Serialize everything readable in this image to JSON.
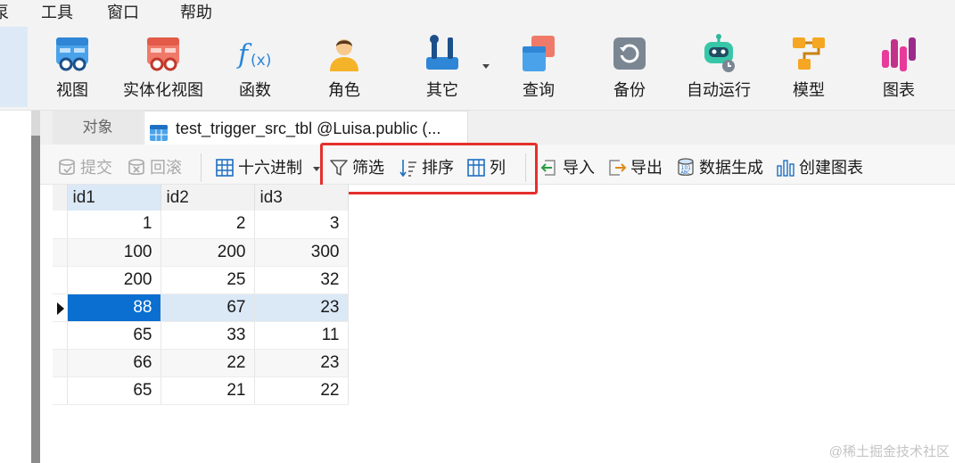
{
  "menu": {
    "items": [
      "泵",
      "工具",
      "窗口",
      "帮助"
    ]
  },
  "ribbon": {
    "buttons": [
      {
        "label": "视图",
        "icon": "view-icon"
      },
      {
        "label": "实体化视图",
        "icon": "materialized-view-icon"
      },
      {
        "label": "函数",
        "icon": "function-icon"
      },
      {
        "label": "角色",
        "icon": "role-icon"
      },
      {
        "label": "其它",
        "icon": "tools-icon"
      },
      {
        "label": "查询",
        "icon": "query-icon"
      },
      {
        "label": "备份",
        "icon": "backup-icon"
      },
      {
        "label": "自动运行",
        "icon": "robot-icon"
      },
      {
        "label": "模型",
        "icon": "model-icon"
      },
      {
        "label": "图表",
        "icon": "chart-icon"
      }
    ]
  },
  "tabs": {
    "objects_label": "对象",
    "active_label": "test_trigger_src_tbl @Luisa.public (..."
  },
  "toolbar": {
    "commit": "提交",
    "rollback": "回滚",
    "hex": "十六进制",
    "filter": "筛选",
    "sort": "排序",
    "columns": "列",
    "import": "导入",
    "export": "导出",
    "datagen": "数据生成",
    "create_chart": "创建图表"
  },
  "grid": {
    "columns": [
      "id1",
      "id2",
      "id3"
    ],
    "rows": [
      [
        "1",
        "2",
        "3"
      ],
      [
        "100",
        "200",
        "300"
      ],
      [
        "200",
        "25",
        "32"
      ],
      [
        "88",
        "67",
        "23"
      ],
      [
        "65",
        "33",
        "11"
      ],
      [
        "66",
        "22",
        "23"
      ],
      [
        "65",
        "21",
        "22"
      ]
    ],
    "current_row": 3
  },
  "watermark": "@稀土掘金技术社区",
  "colors": {
    "accent": "#0a6fd0",
    "highlight_box": "#e5302c"
  }
}
